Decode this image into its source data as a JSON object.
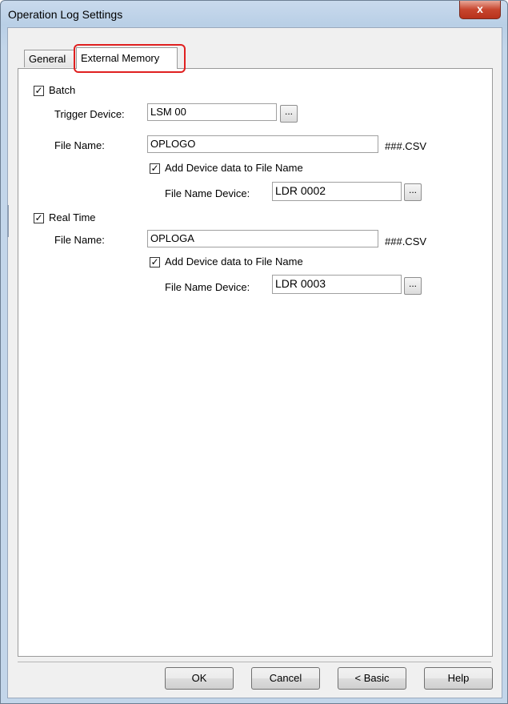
{
  "window": {
    "title": "Operation Log Settings",
    "close_label": "x"
  },
  "tabs": [
    {
      "label": "General",
      "active": false
    },
    {
      "label": "External Memory",
      "active": true
    }
  ],
  "batch": {
    "checkbox_label": "Batch",
    "checked": true,
    "trigger_label": "Trigger Device:",
    "trigger_value": "LSM 00",
    "filename_label": "File Name:",
    "filename_value": "OPLOGO",
    "suffix": "###.CSV",
    "add_device_label": "Add Device data to File Name",
    "add_device_checked": true,
    "device_label": "File Name Device:",
    "device_value": "LDR 0002"
  },
  "realtime": {
    "checkbox_label": "Real Time",
    "checked": true,
    "filename_label": "File Name:",
    "filename_value": "OPLOGA",
    "suffix": "###.CSV",
    "add_device_label": "Add Device data to File Name",
    "add_device_checked": true,
    "device_label": "File Name Device:",
    "device_value": "LDR 0003"
  },
  "browse_label": "...",
  "check_mark": "✓",
  "buttons": {
    "ok": "OK",
    "cancel": "Cancel",
    "basic": "< Basic",
    "help": "Help"
  }
}
